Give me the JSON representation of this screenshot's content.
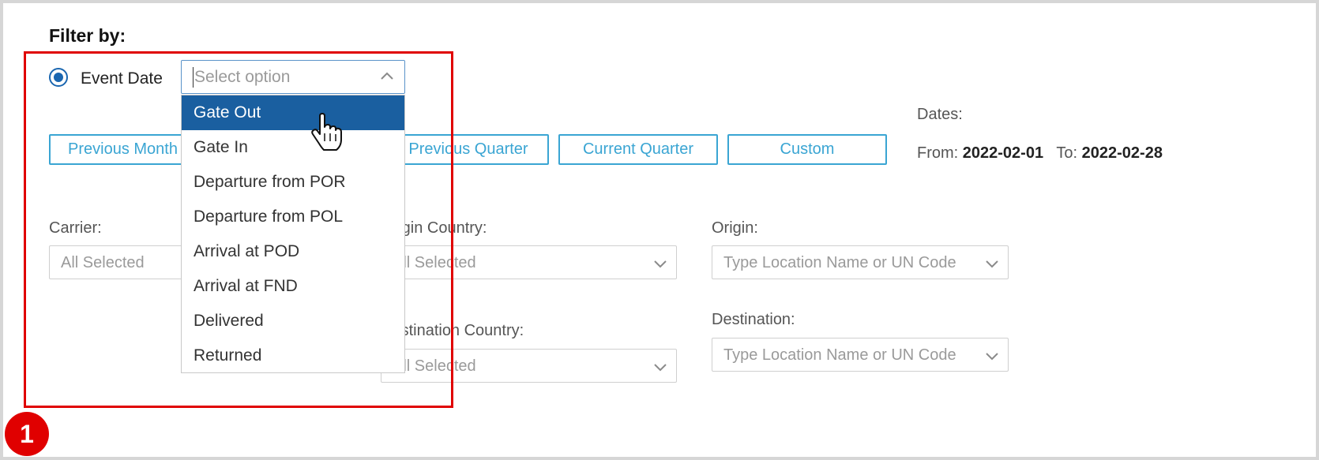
{
  "filter": {
    "title": "Filter by:"
  },
  "event_date": {
    "radio_label": "Event Date",
    "select_placeholder": "Select option",
    "options": [
      "Gate Out",
      "Gate In",
      "Departure from POR",
      "Departure from POL",
      "Arrival at POD",
      "Arrival at FND",
      "Delivered",
      "Returned"
    ]
  },
  "period_buttons": {
    "previous_month": "Previous Month",
    "previous_quarter": "Previous Quarter",
    "current_quarter": "Current Quarter",
    "custom": "Custom"
  },
  "dates": {
    "label": "Dates:",
    "from_label": "From:",
    "from_value": "2022-02-01",
    "to_label": "To:",
    "to_value": "2022-02-28"
  },
  "fields": {
    "carrier": {
      "label": "Carrier:",
      "value": "All Selected"
    },
    "origin_country": {
      "label": "Origin Country:",
      "value": "All Selected"
    },
    "origin": {
      "label": "Origin:",
      "placeholder": "Type Location Name or UN Code"
    },
    "destination_country": {
      "label": "Destination Country:",
      "value": "All Selected"
    },
    "destination": {
      "label": "Destination:",
      "placeholder": "Type Location Name or UN Code"
    }
  },
  "annotation": {
    "badge": "1"
  },
  "colors": {
    "accent": "#1a5fa0",
    "button_border": "#3aa5d3",
    "highlight": "#e00000"
  }
}
